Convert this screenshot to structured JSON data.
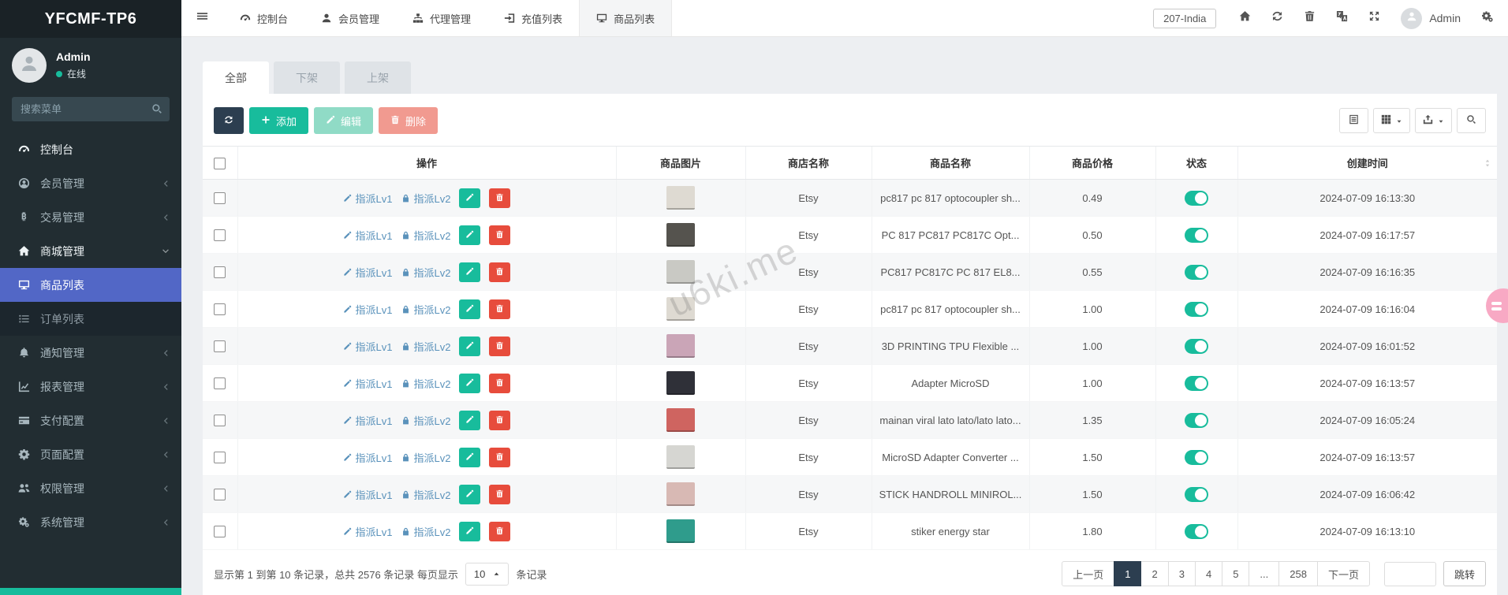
{
  "brand": "YFCMF-TP6",
  "user_panel": {
    "name": "Admin",
    "status": "在线"
  },
  "sidebar": {
    "search_placeholder": "搜索菜单",
    "items": [
      {
        "icon": "tachometer",
        "label": "控制台",
        "state": "bright"
      },
      {
        "icon": "user-circle",
        "label": "会员管理",
        "chevron": "chevron-left"
      },
      {
        "icon": "btc",
        "label": "交易管理",
        "chevron": "chevron-left"
      },
      {
        "icon": "home",
        "label": "商城管理",
        "chevron": "chevron-down",
        "state": "bright"
      },
      {
        "icon": "desktop",
        "label": "商品列表",
        "state": "active"
      },
      {
        "icon": "list",
        "label": "订单列表",
        "state": "submenu"
      },
      {
        "icon": "bell",
        "label": "通知管理",
        "chevron": "chevron-left"
      },
      {
        "icon": "chart-line",
        "label": "报表管理",
        "chevron": "chevron-left"
      },
      {
        "icon": "credit-card",
        "label": "支付配置",
        "chevron": "chevron-left"
      },
      {
        "icon": "gear",
        "label": "页面配置",
        "chevron": "chevron-left"
      },
      {
        "icon": "users",
        "label": "权限管理",
        "chevron": "chevron-left"
      },
      {
        "icon": "cogs",
        "label": "系统管理",
        "chevron": "chevron-left"
      }
    ]
  },
  "topnav": {
    "items": [
      {
        "icon": "tachometer",
        "label": "控制台"
      },
      {
        "icon": "user",
        "label": "会员管理"
      },
      {
        "icon": "sitemap",
        "label": "代理管理"
      },
      {
        "icon": "signin",
        "label": "充值列表"
      },
      {
        "icon": "desktop",
        "label": "商品列表",
        "state": "active"
      }
    ],
    "right": {
      "badge": "207-India",
      "icons": [
        {
          "icon": "home"
        },
        {
          "icon": "refresh"
        },
        {
          "icon": "trash"
        },
        {
          "icon": "translate"
        },
        {
          "icon": "expand"
        }
      ],
      "username": "Admin"
    }
  },
  "tabs": [
    {
      "label": "全部",
      "state": "active"
    },
    {
      "label": "下架"
    },
    {
      "label": "上架"
    }
  ],
  "toolbar": {
    "add_label": "添加",
    "edit_label": "编辑",
    "delete_label": "删除"
  },
  "table": {
    "headers": [
      "操作",
      "商品图片",
      "商店名称",
      "商品名称",
      "商品价格",
      "状态",
      "创建时间"
    ],
    "assign1": "指派Lv1",
    "assign2": "指派Lv2",
    "rows": [
      {
        "store": "Etsy",
        "name": "pc817 pc 817 optocoupler sh...",
        "price": "0.49",
        "time": "2024-07-09 16:13:30",
        "thumb": "#dedad2"
      },
      {
        "store": "Etsy",
        "name": "PC 817 PC817 PC817C Opt...",
        "price": "0.50",
        "time": "2024-07-09 16:17:57",
        "thumb": "#55534e"
      },
      {
        "store": "Etsy",
        "name": "PC817 PC817C PC 817 EL8...",
        "price": "0.55",
        "time": "2024-07-09 16:16:35",
        "thumb": "#c9c9c4"
      },
      {
        "store": "Etsy",
        "name": "pc817 pc 817 optocoupler sh...",
        "price": "1.00",
        "time": "2024-07-09 16:16:04",
        "thumb": "#dedad2"
      },
      {
        "store": "Etsy",
        "name": "3D PRINTING TPU Flexible ...",
        "price": "1.00",
        "time": "2024-07-09 16:01:52",
        "thumb": "#caa5b7"
      },
      {
        "store": "Etsy",
        "name": "Adapter MicroSD",
        "price": "1.00",
        "time": "2024-07-09 16:13:57",
        "thumb": "#2f3038"
      },
      {
        "store": "Etsy",
        "name": "mainan viral lato lato/lato lato...",
        "price": "1.35",
        "time": "2024-07-09 16:05:24",
        "thumb": "#cf6460"
      },
      {
        "store": "Etsy",
        "name": "MicroSD Adapter Converter ...",
        "price": "1.50",
        "time": "2024-07-09 16:13:57",
        "thumb": "#d6d6d2"
      },
      {
        "store": "Etsy",
        "name": "STICK HANDROLL MINIROL...",
        "price": "1.50",
        "time": "2024-07-09 16:06:42",
        "thumb": "#d8b9b4"
      },
      {
        "store": "Etsy",
        "name": "stiker energy star",
        "price": "1.80",
        "time": "2024-07-09 16:13:10",
        "thumb": "#2f9c8c"
      }
    ]
  },
  "pagination": {
    "summary_prefix": "显示第 1 到第 10 条记录，总共 2576 条记录 每页显示",
    "page_size": "10",
    "summary_suffix": "条记录",
    "pages": [
      {
        "label": "上一页"
      },
      {
        "label": "1",
        "state": "active"
      },
      {
        "label": "2"
      },
      {
        "label": "3"
      },
      {
        "label": "4"
      },
      {
        "label": "5"
      },
      {
        "label": "..."
      },
      {
        "label": "258"
      },
      {
        "label": "下一页"
      }
    ],
    "jump_label": "跳转"
  },
  "watermark": "u6ki.me",
  "colors": {
    "accent": "#18bc9c",
    "active_menu": "#5267c6",
    "navy": "#2c3e50",
    "danger": "#e74c3c"
  }
}
